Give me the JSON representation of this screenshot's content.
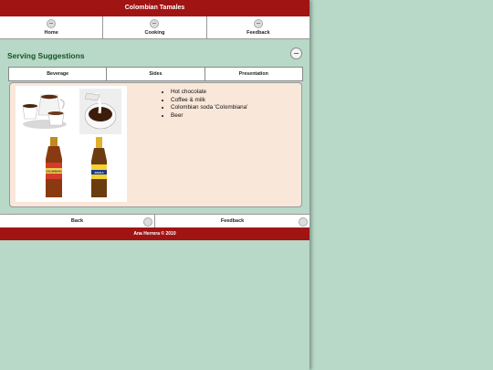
{
  "app": {
    "title": "Colombian Tamales"
  },
  "nav": {
    "items": [
      {
        "label": "Home",
        "icon": "home-icon"
      },
      {
        "label": "Cooking",
        "icon": "cooking-icon"
      },
      {
        "label": "Feedback",
        "icon": "feedback-icon"
      }
    ]
  },
  "page": {
    "title": "Serving Suggestions"
  },
  "tabs": [
    "Beverage",
    "Sides",
    "Presentation"
  ],
  "beverage": {
    "items": [
      "Hot chocolate",
      "Coffee & milk",
      "Colombian soda 'Colombiana'",
      "Beer"
    ],
    "bottle_labels": [
      "COLOMBIANA",
      "AGUILA"
    ]
  },
  "footer": {
    "back_label": "Back",
    "feedback_label": "Feedback",
    "credit": "Ana Herrera © 2010"
  },
  "colors": {
    "brand": "#a11414",
    "title_green": "#13561f",
    "background": "#b8d8c8",
    "panel": "#f9e7da"
  }
}
